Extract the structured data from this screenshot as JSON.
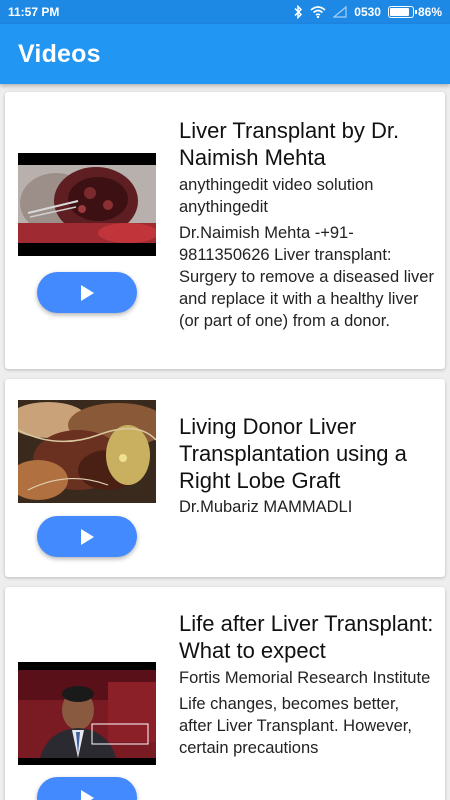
{
  "status_bar": {
    "time": "11:57 PM",
    "network": "0530",
    "battery": "86%",
    "battery_level": 0.86,
    "icons": [
      "bluetooth-icon",
      "wifi-icon",
      "signal-icon",
      "battery-icon"
    ]
  },
  "app_bar": {
    "title": "Videos"
  },
  "colors": {
    "status_bar": "#1e88e5",
    "app_bar": "#2196f3",
    "play_button": "#448aff",
    "background": "#eeeeee"
  },
  "videos": [
    {
      "title": "Liver Transplant by Dr. Naimish Mehta",
      "author": "anythingedit video solution anythingedit",
      "description": "Dr.Naimish Mehta -+91-9811350626 Liver transplant: Surgery to remove a diseased liver and replace it with a healthy liver (or part of one) from a donor."
    },
    {
      "title": "Living Donor Liver Transplantation using a Right Lobe Graft",
      "author": "Dr.Mubariz MAMMADLI",
      "description": ""
    },
    {
      "title": "Life after Liver Transplant: What to expect",
      "author": "Fortis Memorial Research Institute",
      "description": "Life changes, becomes better, after Liver Transplant. However, certain precautions"
    }
  ]
}
